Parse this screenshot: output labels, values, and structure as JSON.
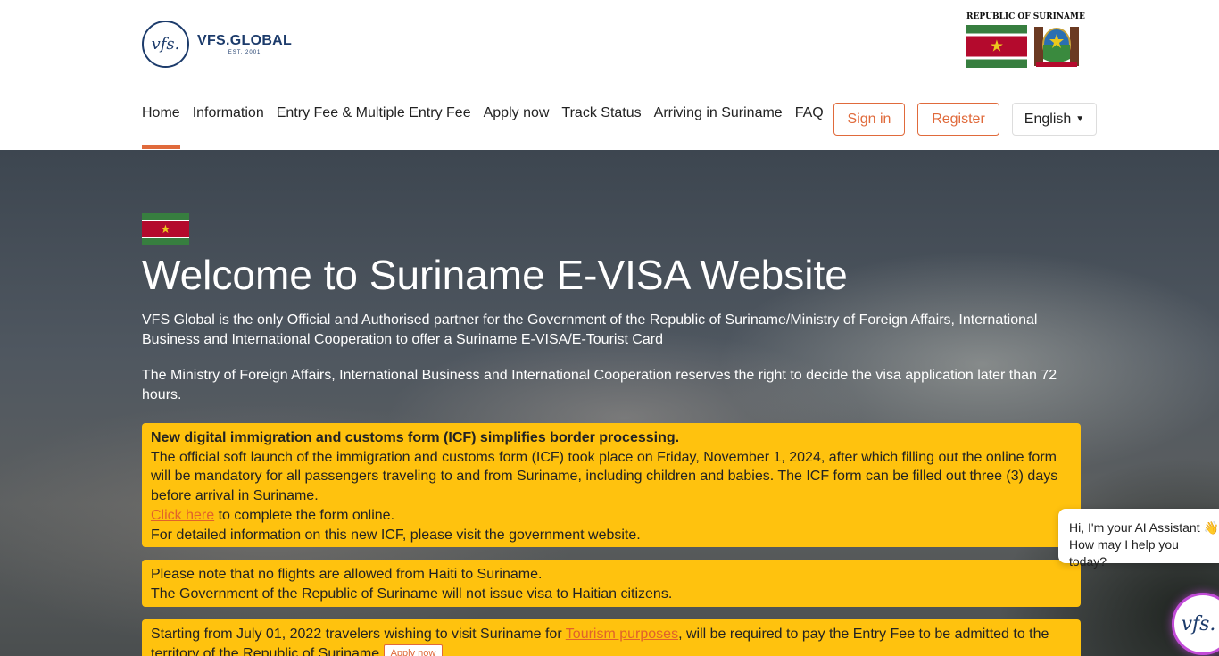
{
  "brand": {
    "logo_mark": "vfs.",
    "name": "VFS.GLOBAL",
    "est": "EST. 2001"
  },
  "republic": {
    "title": "REPUBLIC OF SURINAME"
  },
  "nav": {
    "items": [
      {
        "label": "Home"
      },
      {
        "label": "Information"
      },
      {
        "label": "Entry Fee & Multiple Entry Fee"
      },
      {
        "label": "Apply now"
      },
      {
        "label": "Track Status"
      },
      {
        "label": "Arriving in Suriname"
      },
      {
        "label": "FAQ"
      }
    ],
    "signin": "Sign in",
    "register": "Register",
    "language": "English"
  },
  "hero": {
    "title": "Welcome to Suriname E-VISA Website",
    "p1": "VFS Global is the only Official and Authorised partner for the Government of the Republic of Suriname/Ministry of Foreign Affairs, International Business and International Cooperation to offer a Suriname E-VISA/E-Tourist Card",
    "p2": "The Ministry of Foreign Affairs, International Business and International Cooperation reserves the right to decide the visa application later than 72 hours."
  },
  "notices": {
    "icf": {
      "heading": "New digital immigration and customs form (ICF) simplifies border processing.",
      "body": "The official soft launch of the immigration and customs form (ICF) took place on Friday, November 1, 2024, after which filling out the online form will be mandatory for all passengers traveling to and from Suriname, including children and babies. The ICF form can be filled out three (3) days before arrival in Suriname.",
      "link": "Click here",
      "link_after": " to complete the form online.",
      "details": "For detailed information on this new ICF, please visit the government website."
    },
    "haiti": {
      "line1": "Please note that no flights are allowed from Haiti to Suriname.",
      "line2": "The Government of the Republic of Suriname will not issue visa to Haitian citizens."
    },
    "tourism": {
      "before": "Starting from July 01, 2022 travelers wishing to visit Suriname for ",
      "link": "Tourism purposes",
      "after": ", will be required to pay the Entry Fee to be admitted to the territory of the Republic of Suriname.",
      "button": "Apply now"
    }
  },
  "chat": {
    "line1": "Hi, I'm your AI Assistant 👋",
    "line2": "How may I help you today?",
    "avatar": "vfs."
  },
  "colors": {
    "accent": "#e06a3b",
    "notice": "#ffc20e",
    "brand_blue": "#1c3b6b"
  }
}
